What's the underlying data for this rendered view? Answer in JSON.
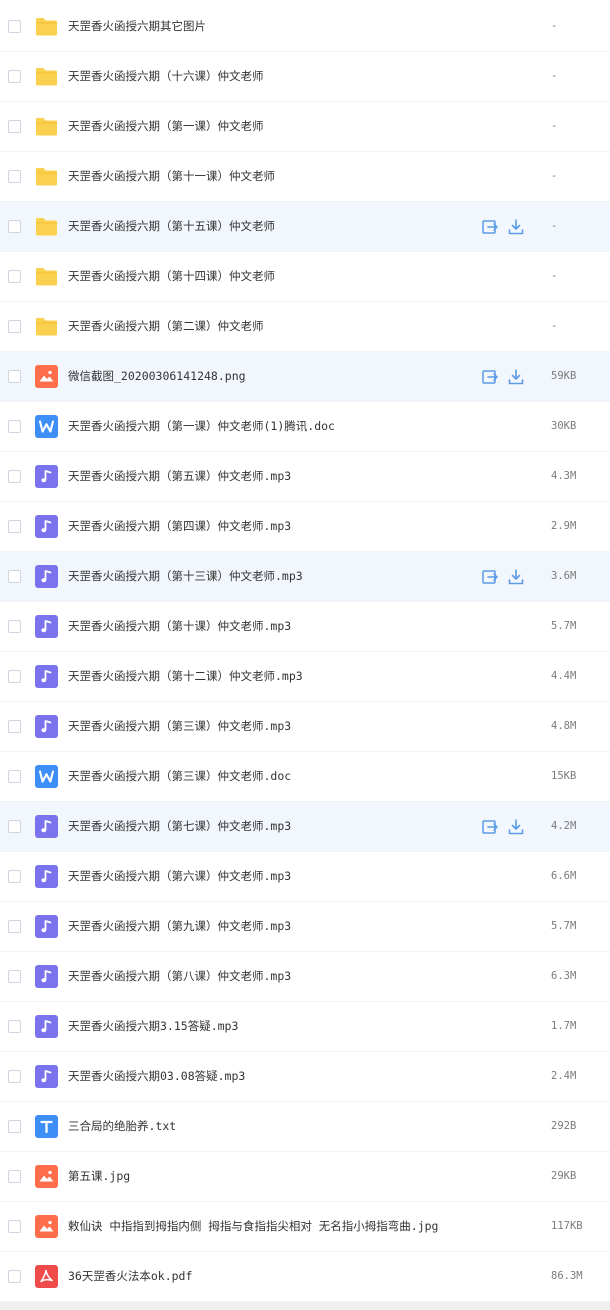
{
  "colors": {
    "folder": "#fcd04f",
    "image": "#ff6e4a",
    "word": "#3e8ef7",
    "music": "#7b72ed",
    "text": "#3e8ef7",
    "pdf": "#f04b4b",
    "action": "#5b9be6",
    "hover_row": "#f2f7fd"
  },
  "files": [
    {
      "name": "天罡香火函授六期其它图片",
      "size": "-",
      "type": "folder",
      "icon": "folder-icon",
      "hover": false
    },
    {
      "name": "天罡香火函授六期（十六课）仲文老师",
      "size": "-",
      "type": "folder",
      "icon": "folder-icon",
      "hover": false
    },
    {
      "name": "天罡香火函授六期（第一课）仲文老师",
      "size": "-",
      "type": "folder",
      "icon": "folder-icon",
      "hover": false
    },
    {
      "name": "天罡香火函授六期（第十一课）仲文老师",
      "size": "-",
      "type": "folder",
      "icon": "folder-icon",
      "hover": false
    },
    {
      "name": "天罡香火函授六期（第十五课）仲文老师",
      "size": "-",
      "type": "folder",
      "icon": "folder-icon",
      "hover": true
    },
    {
      "name": "天罡香火函授六期（第十四课）仲文老师",
      "size": "-",
      "type": "folder",
      "icon": "folder-icon",
      "hover": false
    },
    {
      "name": "天罡香火函授六期（第二课）仲文老师",
      "size": "-",
      "type": "folder",
      "icon": "folder-icon",
      "hover": false
    },
    {
      "name": "微信截图_20200306141248.png",
      "size": "59KB",
      "type": "image",
      "icon": "image-file-icon",
      "hover": true
    },
    {
      "name": "天罡香火函授六期（第一课）仲文老师(1)腾讯.doc",
      "size": "30KB",
      "type": "word",
      "icon": "word-file-icon",
      "hover": false
    },
    {
      "name": "天罡香火函授六期（第五课）仲文老师.mp3",
      "size": "4.3M",
      "type": "music",
      "icon": "music-file-icon",
      "hover": false
    },
    {
      "name": "天罡香火函授六期（第四课）仲文老师.mp3",
      "size": "2.9M",
      "type": "music",
      "icon": "music-file-icon",
      "hover": false
    },
    {
      "name": "天罡香火函授六期（第十三课）仲文老师.mp3",
      "size": "3.6M",
      "type": "music",
      "icon": "music-file-icon",
      "hover": true
    },
    {
      "name": "天罡香火函授六期（第十课）仲文老师.mp3",
      "size": "5.7M",
      "type": "music",
      "icon": "music-file-icon",
      "hover": false
    },
    {
      "name": "天罡香火函授六期（第十二课）仲文老师.mp3",
      "size": "4.4M",
      "type": "music",
      "icon": "music-file-icon",
      "hover": false
    },
    {
      "name": "天罡香火函授六期（第三课）仲文老师.mp3",
      "size": "4.8M",
      "type": "music",
      "icon": "music-file-icon",
      "hover": false
    },
    {
      "name": "天罡香火函授六期（第三课）仲文老师.doc",
      "size": "15KB",
      "type": "word",
      "icon": "word-file-icon",
      "hover": false
    },
    {
      "name": "天罡香火函授六期（第七课）仲文老师.mp3",
      "size": "4.2M",
      "type": "music",
      "icon": "music-file-icon",
      "hover": true
    },
    {
      "name": "天罡香火函授六期（第六课）仲文老师.mp3",
      "size": "6.6M",
      "type": "music",
      "icon": "music-file-icon",
      "hover": false
    },
    {
      "name": "天罡香火函授六期（第九课）仲文老师.mp3",
      "size": "5.7M",
      "type": "music",
      "icon": "music-file-icon",
      "hover": false
    },
    {
      "name": "天罡香火函授六期（第八课）仲文老师.mp3",
      "size": "6.3M",
      "type": "music",
      "icon": "music-file-icon",
      "hover": false
    },
    {
      "name": "天罡香火函授六期3.15答疑.mp3",
      "size": "1.7M",
      "type": "music",
      "icon": "music-file-icon",
      "hover": false
    },
    {
      "name": "天罡香火函授六期03.08答疑.mp3",
      "size": "2.4M",
      "type": "music",
      "icon": "music-file-icon",
      "hover": false
    },
    {
      "name": "三合局的绝胎养.txt",
      "size": "292B",
      "type": "text",
      "icon": "text-file-icon",
      "hover": false
    },
    {
      "name": "第五课.jpg",
      "size": "29KB",
      "type": "image",
      "icon": "image-file-icon",
      "hover": false
    },
    {
      "name": "敕仙诀 中指指到拇指内侧 拇指与食指指尖相对 无名指小拇指弯曲.jpg",
      "size": "117KB",
      "type": "image",
      "icon": "image-file-icon",
      "hover": false
    },
    {
      "name": "36天罡香火法本ok.pdf",
      "size": "86.3M",
      "type": "pdf",
      "icon": "pdf-file-icon",
      "hover": false
    }
  ]
}
